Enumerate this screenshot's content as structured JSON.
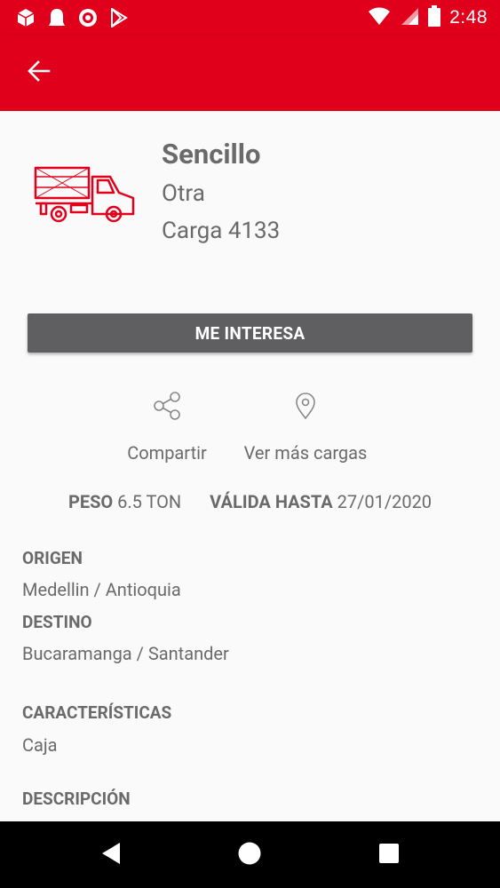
{
  "status_bar": {
    "time": "2:48"
  },
  "load": {
    "title": "Sencillo",
    "subtitle": "Otra",
    "code": "Carga 4133"
  },
  "actions": {
    "interest_label": "ME INTERESA",
    "share_label": "Compartir",
    "more_label": "Ver más cargas"
  },
  "meta": {
    "weight_label": "PESO",
    "weight_value": "6.5 TON",
    "valid_label": "VÁLIDA HASTA",
    "valid_value": "27/01/2020"
  },
  "details": {
    "origin_label": "ORIGEN",
    "origin_value": "Medellin / Antioquia",
    "destination_label": "DESTINO",
    "destination_value": "Bucaramanga / Santander",
    "features_label": "CARACTERÍSTICAS",
    "features_value": "Caja",
    "description_label": "DESCRIPCIÓN"
  },
  "colors": {
    "brand": "#e0001b",
    "button": "#5f5f62",
    "text": "#6a6a6a"
  }
}
